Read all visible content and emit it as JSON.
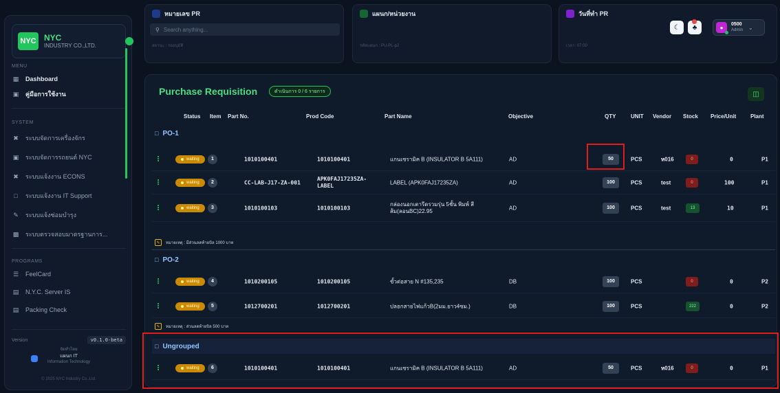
{
  "brand": {
    "logo": "NYC",
    "name": "NYC",
    "sub": "INDUSTRY CO.,LTD."
  },
  "sidebar": {
    "menu_label": "MENU",
    "menu_items": [
      {
        "label": "Dashboard",
        "icon": "grid-icon"
      },
      {
        "label": "คู่มือการใช้งาน",
        "icon": "book-icon"
      }
    ],
    "system_label": "SYSTEM",
    "system_items": [
      {
        "label": "ระบบจัดการเครื่องจักร",
        "icon": "tools-icon"
      },
      {
        "label": "ระบบจัดการรถยนต์ NYC",
        "icon": "car-icon"
      },
      {
        "label": "ระบบแจ้งงาน ECONS",
        "icon": "tools-icon"
      },
      {
        "label": "ระบบแจ้งงาน IT Support",
        "icon": "monitor-icon"
      },
      {
        "label": "ระบบแจ้งซ่อมบำรุง",
        "icon": "wrench-icon"
      },
      {
        "label": "ระบบตรวจสอบมาตรฐานการ...",
        "icon": "clipboard-icon"
      }
    ],
    "programs_label": "PROGRAMS",
    "program_items": [
      {
        "label": "FeelCard",
        "icon": "card-icon"
      },
      {
        "label": "N.Y.C. Server IS",
        "icon": "server-icon"
      },
      {
        "label": "Packing Check",
        "icon": "box-icon"
      }
    ],
    "version_label": "Version",
    "version_value": "v0.1.0-beta",
    "footer_top": "จัดทำโดย",
    "footer_dept": "แผนก IT",
    "footer_dept_sub": "Information Technology",
    "copyright": "© 2025 NYC Industry Co.,Ltd."
  },
  "topcards": [
    {
      "title": "หมายเลข PR",
      "sub": "สถานะ : รออนุมัติ"
    },
    {
      "title": "แผนก/หน่วยงาน",
      "sub": "รหัสแผนก : PU-PL-p2"
    },
    {
      "title": "วันที่ทำ PR",
      "sub": "เวลา: 07:00"
    }
  ],
  "search": {
    "placeholder": "Search anything..."
  },
  "user": {
    "code": "0500",
    "role": "Admin"
  },
  "panel": {
    "title": "Purchase Requisition",
    "badge": "ดำเนินการ 0 / 6 รายการ"
  },
  "columns": {
    "status": "Status",
    "item": "Item",
    "part_no": "Part No.",
    "prod_code": "Prod Code",
    "part_name": "Part Name",
    "objective": "Objective",
    "qty": "QTY",
    "unit": "UNIT",
    "vendor": "Vendor",
    "stock": "Stock",
    "price": "Price/Unit",
    "plant": "Plant"
  },
  "groups": [
    {
      "name": "PO-1",
      "rows": [
        {
          "status": "waiting",
          "item": "1",
          "part_no": "1010100401",
          "prod_code": "1010100401",
          "part_name": "แกนเซรามิค B (INSULATOR B 5A111)",
          "objective": "AD",
          "qty": "50",
          "unit": "PCS",
          "vendor": "ห016",
          "stock": "0",
          "price": "0",
          "plant": "P1"
        },
        {
          "status": "waiting",
          "item": "2",
          "part_no": "CC-LAB-J17-ZA-001",
          "prod_code": "APK0FAJ17235ZA-LABEL",
          "part_name": "LABEL (APK0FAJ17235ZA)",
          "objective": "AD",
          "qty": "100",
          "unit": "PCS",
          "vendor": "test",
          "stock": "0",
          "price": "100",
          "plant": "P1"
        },
        {
          "status": "waiting",
          "item": "3",
          "part_no": "1010100103",
          "prod_code": "1010100103",
          "part_name": "กล่องนอกเตารีดรวมรุ่น 5ชั้น พิมพ์ สีส้ม(ลอนBC)22.95",
          "objective": "AD",
          "qty": "100",
          "unit": "PCS",
          "vendor": "test",
          "stock": "13",
          "price": "10",
          "plant": "P1"
        }
      ],
      "note": "หมายเหตุ : มีส่วนลดท้ายบิล 1000 บาท"
    },
    {
      "name": "PO-2",
      "rows": [
        {
          "status": "waiting",
          "item": "4",
          "part_no": "1010200105",
          "prod_code": "1010200105",
          "part_name": "ขั้วต่อสาย N #135,235",
          "objective": "DB",
          "qty": "100",
          "unit": "PCS",
          "vendor": "",
          "stock": "0",
          "price": "0",
          "plant": "P2"
        },
        {
          "status": "waiting",
          "item": "5",
          "part_no": "1012700201",
          "prod_code": "1012700201",
          "part_name": "ปลอกสายไฟแก้วB(2มม.ยาว4ซม.)",
          "objective": "DB",
          "qty": "100",
          "unit": "PCS",
          "vendor": "",
          "stock": "222",
          "price": "0",
          "plant": "P2"
        }
      ],
      "note": "หมายเหตุ : ส่วนลดท้ายบิล 500 บาท"
    },
    {
      "name": "Ungrouped",
      "rows": [
        {
          "status": "waiting",
          "item": "6",
          "part_no": "1010100401",
          "prod_code": "1010100401",
          "part_name": "แกนเซรามิค B (INSULATOR B 5A111)",
          "objective": "AD",
          "qty": "50",
          "unit": "PCS",
          "vendor": "ห016",
          "stock": "0",
          "price": "0",
          "plant": "P1"
        }
      ]
    }
  ]
}
